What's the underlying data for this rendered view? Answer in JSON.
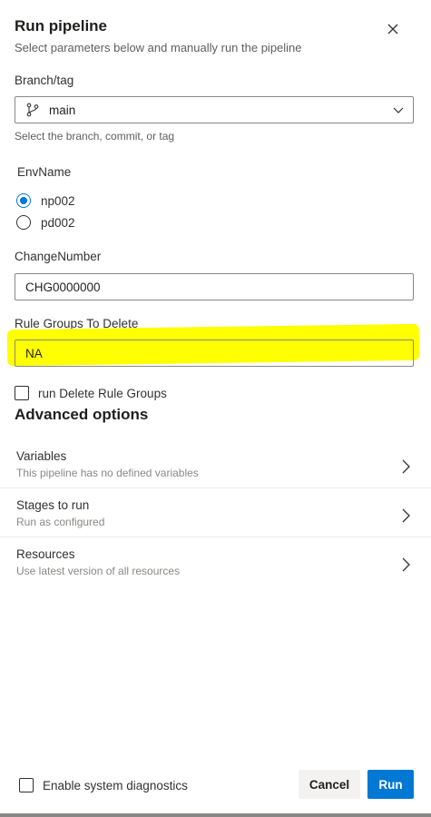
{
  "header": {
    "title": "Run pipeline",
    "subtitle": "Select parameters below and manually run the pipeline",
    "close_icon": "close-icon"
  },
  "branch": {
    "label": "Branch/tag",
    "value": "main",
    "icon": "git-branch-icon",
    "helper": "Select the branch, commit, or tag"
  },
  "env": {
    "label": "EnvName",
    "options": [
      {
        "label": "np002",
        "selected": true
      },
      {
        "label": "pd002",
        "selected": false
      }
    ]
  },
  "change_number": {
    "label": "ChangeNumber",
    "value": "CHG0000000"
  },
  "rule_groups": {
    "label": "Rule Groups To Delete",
    "value": "NA",
    "highlight_color": "#ffff00"
  },
  "run_delete": {
    "label": "run Delete Rule Groups",
    "checked": false
  },
  "advanced": {
    "title": "Advanced options",
    "items": [
      {
        "title": "Variables",
        "subtitle": "This pipeline has no defined variables"
      },
      {
        "title": "Stages to run",
        "subtitle": "Run as configured"
      },
      {
        "title": "Resources",
        "subtitle": "Use latest version of all resources"
      }
    ]
  },
  "footer": {
    "diagnostics_label": "Enable system diagnostics",
    "diagnostics_checked": false,
    "cancel_label": "Cancel",
    "run_label": "Run"
  },
  "colors": {
    "accent": "#0078d4",
    "text": "#201f1e",
    "secondary_text": "#605e5c"
  }
}
